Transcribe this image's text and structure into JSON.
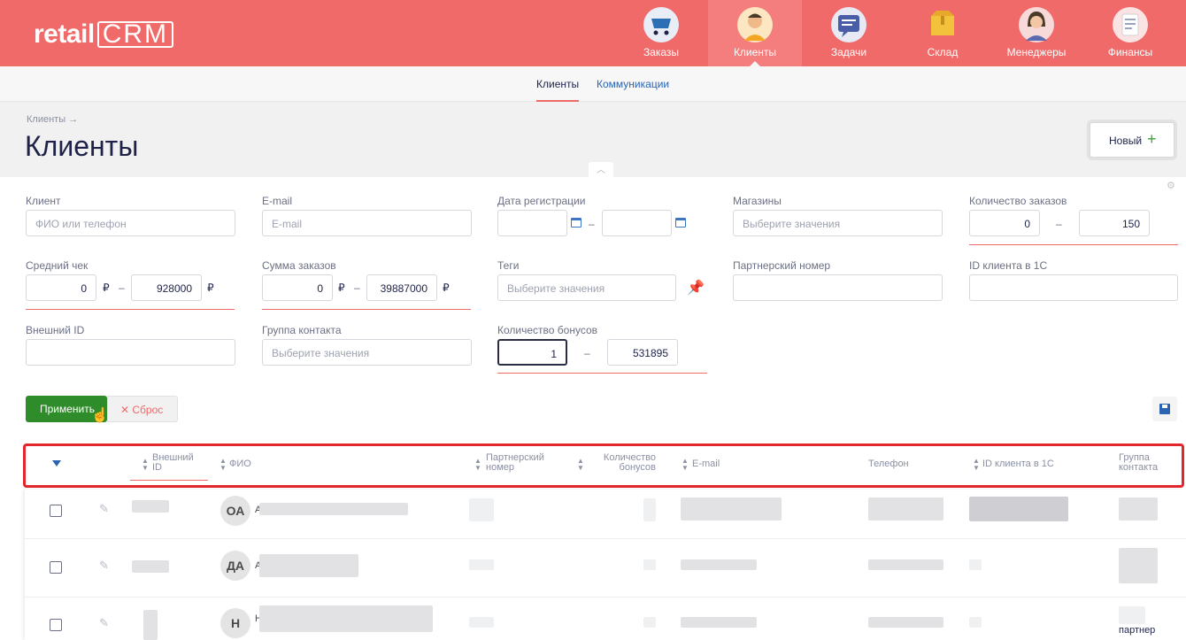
{
  "header": {
    "logo_text": "retail",
    "logo_crm": "CRM",
    "nav": [
      {
        "label": "Заказы",
        "icon": "cart-icon",
        "color": "#2d6fb5"
      },
      {
        "label": "Клиенты",
        "icon": "client-avatar-icon",
        "color": "#f4a623",
        "active": true
      },
      {
        "label": "Задачи",
        "icon": "tasks-chat-icon",
        "color": "#4a5ea8"
      },
      {
        "label": "Склад",
        "icon": "warehouse-box-icon",
        "color": "#f2c23d"
      },
      {
        "label": "Менеджеры",
        "icon": "manager-avatar-icon",
        "color": "#e05f5f"
      },
      {
        "label": "Финансы",
        "icon": "finance-document-icon",
        "color": "#ffffff"
      }
    ]
  },
  "subnav": {
    "tabs": [
      {
        "label": "Клиенты",
        "active": true
      },
      {
        "label": "Коммуникации",
        "active": false
      }
    ]
  },
  "page": {
    "breadcrumb": "Клиенты →",
    "title": "Клиенты",
    "new_button": "Новый",
    "new_button_icon": "plus-icon",
    "collapse_icon": "chevron-up-icon"
  },
  "filters": {
    "client": {
      "label": "Клиент",
      "placeholder": "ФИО или телефон"
    },
    "email": {
      "label": "E-mail",
      "placeholder": "E-mail"
    },
    "reg_date": {
      "label": "Дата регистрации",
      "separator": "–"
    },
    "shops": {
      "label": "Магазины",
      "placeholder": "Выберите значения"
    },
    "orders_count": {
      "label": "Количество заказов",
      "from": "0",
      "to": "150",
      "separator": "–"
    },
    "avg_check": {
      "label": "Средний чек",
      "from": "0",
      "to": "928000",
      "currency": "₽",
      "separator": "–"
    },
    "orders_sum": {
      "label": "Сумма заказов",
      "from": "0",
      "to": "39887000",
      "currency": "₽",
      "separator": "–"
    },
    "tags": {
      "label": "Теги",
      "placeholder": "Выберите значения"
    },
    "partner_number": {
      "label": "Партнерский номер"
    },
    "id_1c": {
      "label": "ID клиента в 1С"
    },
    "external_id": {
      "label": "Внешний ID"
    },
    "contact_group": {
      "label": "Группа контакта",
      "placeholder": "Выберите значения"
    },
    "bonus_count": {
      "label": "Количество бонусов",
      "from": "1",
      "to": "531895",
      "separator": "–"
    },
    "apply_button": "Применить",
    "reset_button": "Сброс"
  },
  "table": {
    "columns": {
      "external_id": [
        "Внешний",
        "ID"
      ],
      "fio": "ФИО",
      "partner": [
        "Партнерский",
        "номер"
      ],
      "bonuses": [
        "Количество",
        "бонусов"
      ],
      "email": "E-mail",
      "phone": "Телефон",
      "id_1c": "ID клиента в 1С",
      "group": [
        "Группа",
        "контакта"
      ]
    },
    "rows": [
      {
        "initials": "ОА",
        "name_first_char": "А"
      },
      {
        "initials": "ДА",
        "name_first_char": "А"
      },
      {
        "initials": "Н",
        "name_first_char": "Н",
        "group_partial": "партнер"
      }
    ]
  }
}
